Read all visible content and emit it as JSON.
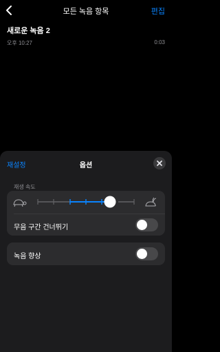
{
  "nav": {
    "title": "모든 녹음 항목",
    "edit_label": "편집"
  },
  "recording": {
    "name": "새로운 녹음 2",
    "time": "오후 10:27",
    "duration": "0:03"
  },
  "options_sheet": {
    "reset_label": "재설정",
    "title": "옵션",
    "playback_speed": {
      "label": "재생 속도",
      "level_fraction": 0.75
    },
    "skip_silence": {
      "label": "무음 구간 건너뛰기",
      "enabled": false
    },
    "enhance_recording": {
      "label": "녹음 향상",
      "enabled": false
    }
  },
  "colors": {
    "accent": "#0a84ff",
    "background": "#000000",
    "sheet": "#1c1c1e",
    "group": "#2c2c2e"
  }
}
